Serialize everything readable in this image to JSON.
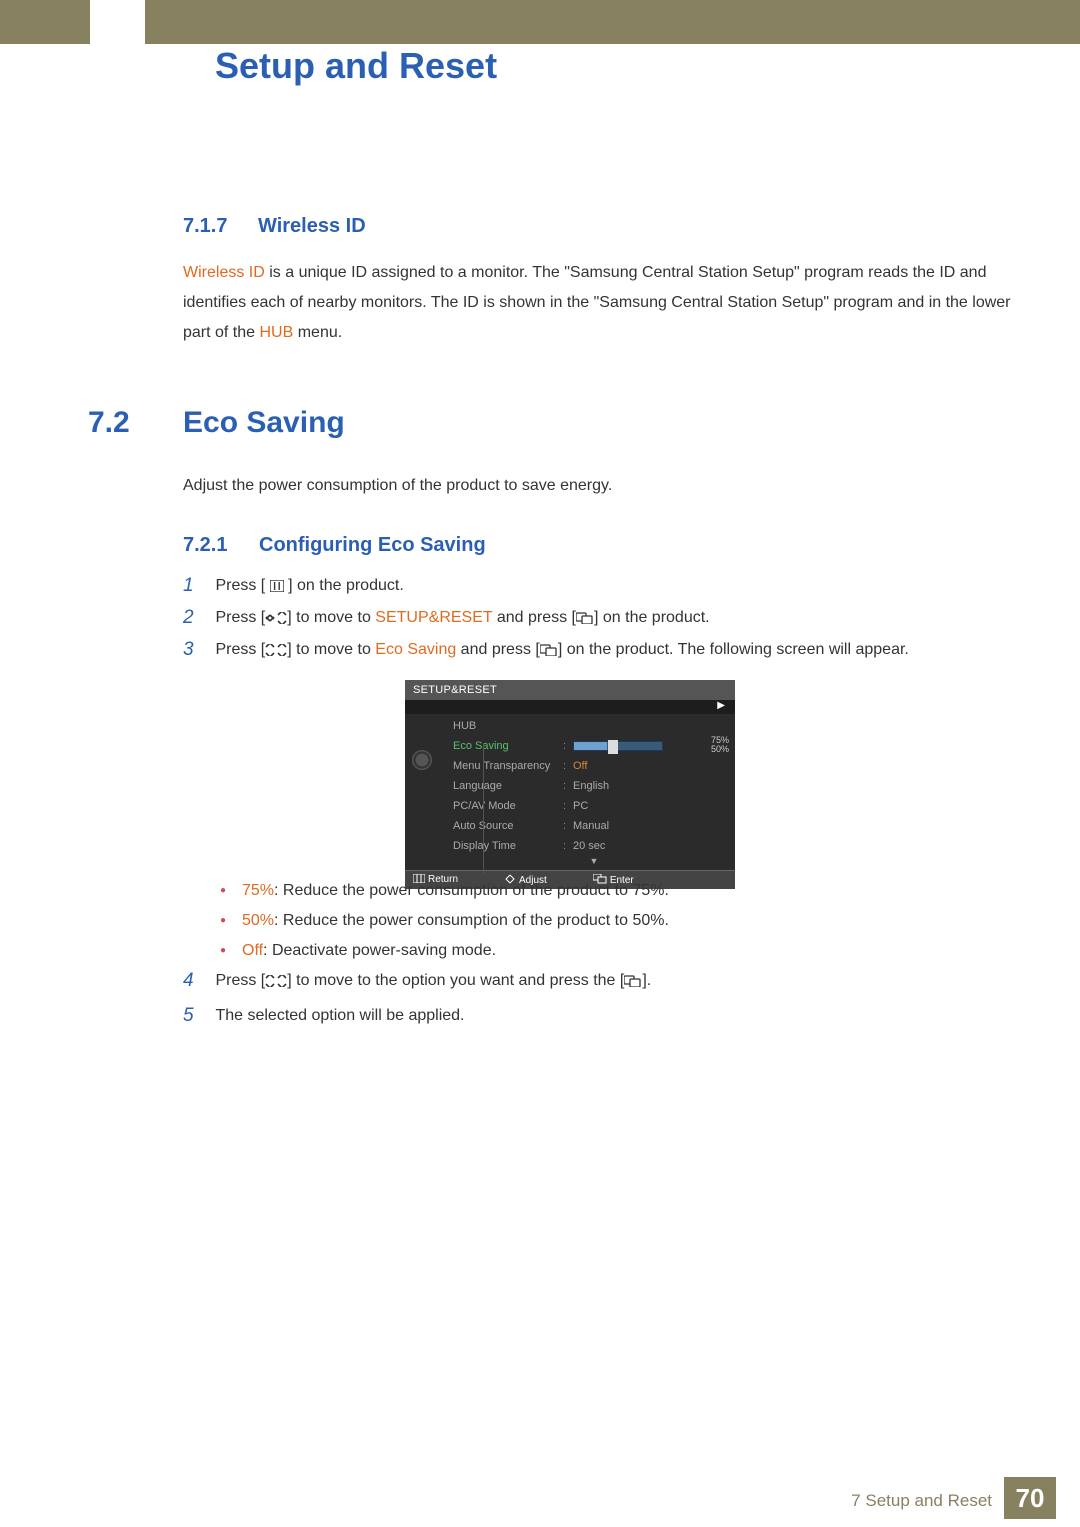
{
  "chapter_title": "Setup and Reset",
  "sec717": {
    "num": "7.1.7",
    "title": "Wireless ID"
  },
  "para717": {
    "kw1": "Wireless ID",
    "t1": " is a unique ID assigned to a monitor. The \"Samsung Central Station Setup\" program reads the ID and identifies each of nearby monitors. The ID is shown in the \"Samsung Central Station Setup\" program and in the lower part of the ",
    "kw2": "HUB",
    "t2": " menu."
  },
  "sec72": {
    "num": "7.2",
    "title": "Eco Saving",
    "para": "Adjust the power consumption of the product to save energy."
  },
  "sec721": {
    "num": "7.2.1",
    "title": "Configuring Eco Saving"
  },
  "steps": {
    "s1a": "Press [ ",
    "s1b": " ] on the product.",
    "s2a": "Press [",
    "s2b": "] to move to ",
    "s2kw": "SETUP&RESET",
    "s2c": " and press [",
    "s2d": "] on the product.",
    "s3a": "Press [",
    "s3b": "] to move to ",
    "s3kw": "Eco Saving",
    "s3c": " and press [",
    "s3d": "] on the product. The following screen will appear.",
    "s4a": "Press [",
    "s4b": "] to move to the option you want and press the [",
    "s4c": "].",
    "s5": "The selected option will be applied."
  },
  "nums": {
    "n1": "1",
    "n2": "2",
    "n3": "3",
    "n4": "4",
    "n5": "5"
  },
  "osd": {
    "title": "SETUP&RESET",
    "rows": {
      "hub": "HUB",
      "eco": "Eco Saving",
      "menu_trans": "Menu Transparency",
      "lang": "Language",
      "pcav": "PC/AV Mode",
      "auto_src": "Auto Source",
      "disp_time": "Display Time"
    },
    "vals": {
      "menu_trans": "Off",
      "lang": "English",
      "pcav": "PC",
      "auto_src": "Manual",
      "disp_time": "20 sec",
      "slider_top": "75%",
      "slider_bot": "50%"
    },
    "footer": {
      "return": "Return",
      "adjust": "Adjust",
      "enter": "Enter"
    }
  },
  "bullets": {
    "b1kw": "75%",
    "b1": ": Reduce the power consumption of the product to 75%.",
    "b2kw": "50%",
    "b2": ": Reduce the power consumption of the product to 50%.",
    "b3kw": "Off",
    "b3": ": Deactivate power-saving mode."
  },
  "footer": {
    "chapter": "7 Setup and Reset",
    "page": "70"
  }
}
